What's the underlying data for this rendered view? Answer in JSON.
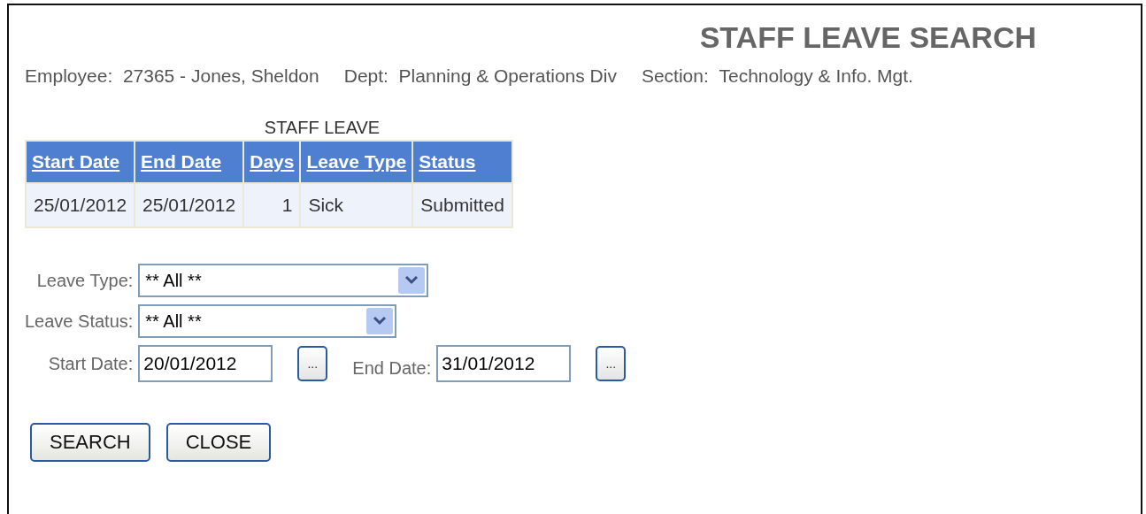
{
  "title": "STAFF LEAVE SEARCH",
  "info": [
    {
      "label": "Employee:",
      "value": "27365 - Jones, Sheldon"
    },
    {
      "label": "Dept:",
      "value": "Planning & Operations Div"
    },
    {
      "label": "Section:",
      "value": "Technology & Info. Mgt."
    }
  ],
  "table": {
    "caption": "STAFF LEAVE",
    "columns": [
      "Start Date",
      "End Date",
      "Days",
      "Leave Type",
      "Status"
    ],
    "rows": [
      [
        "25/01/2012",
        "25/01/2012",
        "1",
        "Sick",
        "Submitted"
      ]
    ]
  },
  "filters": {
    "leave_type": {
      "label": "Leave Type:",
      "value": "** All **"
    },
    "leave_status": {
      "label": "Leave Status:",
      "value": "** All **"
    },
    "start_date": {
      "label": "Start Date:",
      "value": "20/01/2012",
      "picker": "..."
    },
    "end_date": {
      "label": "End Date:",
      "value": "31/01/2012",
      "picker": "..."
    }
  },
  "buttons": [
    "SEARCH",
    "CLOSE"
  ]
}
